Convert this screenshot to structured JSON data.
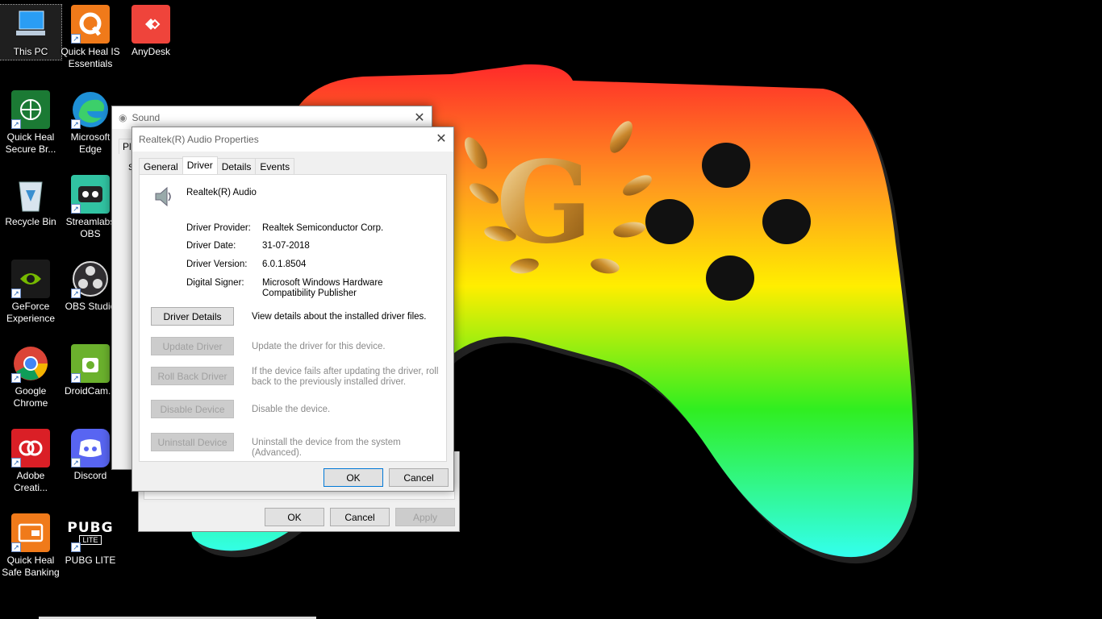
{
  "desktop": {
    "icons": [
      {
        "label": "This PC",
        "icon": "computer-icon"
      },
      {
        "label": "Quick Heal IS Essentials",
        "icon": "quick-heal-icon"
      },
      {
        "label": "AnyDesk",
        "icon": "anydesk-icon"
      },
      {
        "label": "Quick Heal Secure Br...",
        "icon": "quick-heal-browser-icon"
      },
      {
        "label": "Microsoft Edge",
        "icon": "edge-icon"
      },
      {
        "label": "Recycle Bin",
        "icon": "recycle-bin-icon"
      },
      {
        "label": "Streamlabs OBS",
        "icon": "streamlabs-icon"
      },
      {
        "label": "GeForce Experience",
        "icon": "nvidia-icon"
      },
      {
        "label": "OBS Studio",
        "icon": "obs-icon"
      },
      {
        "label": "Google Chrome",
        "icon": "chrome-icon"
      },
      {
        "label": "DroidCam...",
        "icon": "droidcam-icon"
      },
      {
        "label": "Adobe Creati...",
        "icon": "adobe-cc-icon"
      },
      {
        "label": "Discord",
        "icon": "discord-icon"
      },
      {
        "label": "Quick Heal Safe Banking",
        "icon": "safe-banking-icon"
      },
      {
        "label": "PUBG LITE",
        "icon": "pubg-icon"
      }
    ],
    "pubg_icon_text": "PUBG",
    "pubg_icon_subtext": "LITE"
  },
  "sound_window": {
    "title": "Sound",
    "tab_stub": "Pla",
    "side_stub": "S",
    "ok": "OK",
    "cancel": "Cancel",
    "apply": "Apply"
  },
  "props_window": {
    "title": "Realtek(R) Audio Properties",
    "tabs": [
      "General",
      "Driver",
      "Details",
      "Events"
    ],
    "active_tab": "Driver",
    "device_name": "Realtek(R) Audio",
    "device_icon": "speaker-icon",
    "info": [
      {
        "label": "Driver Provider:",
        "value": "Realtek Semiconductor Corp."
      },
      {
        "label": "Driver Date:",
        "value": "31-07-2018"
      },
      {
        "label": "Driver Version:",
        "value": "6.0.1.8504"
      },
      {
        "label": "Digital Signer:",
        "value": "Microsoft Windows Hardware Compatibility Publisher"
      }
    ],
    "actions": [
      {
        "button": "Driver Details",
        "desc": "View details about the installed driver files.",
        "enabled": true
      },
      {
        "button": "Update Driver",
        "desc": "Update the driver for this device.",
        "enabled": false
      },
      {
        "button": "Roll Back Driver",
        "desc": "If the device fails after updating the driver, roll back to the previously installed driver.",
        "enabled": false
      },
      {
        "button": "Disable Device",
        "desc": "Disable the device.",
        "enabled": false
      },
      {
        "button": "Uninstall Device",
        "desc": "Uninstall the device from the system (Advanced).",
        "enabled": false
      }
    ],
    "ok": "OK",
    "cancel": "Cancel"
  },
  "colors": {
    "gamepad_top": "#ff3b30",
    "gamepad_mid": "#ffee00",
    "gamepad_low": "#22ee22",
    "gamepad_bottom": "#33ffee",
    "accent_border": "#0078d7"
  }
}
